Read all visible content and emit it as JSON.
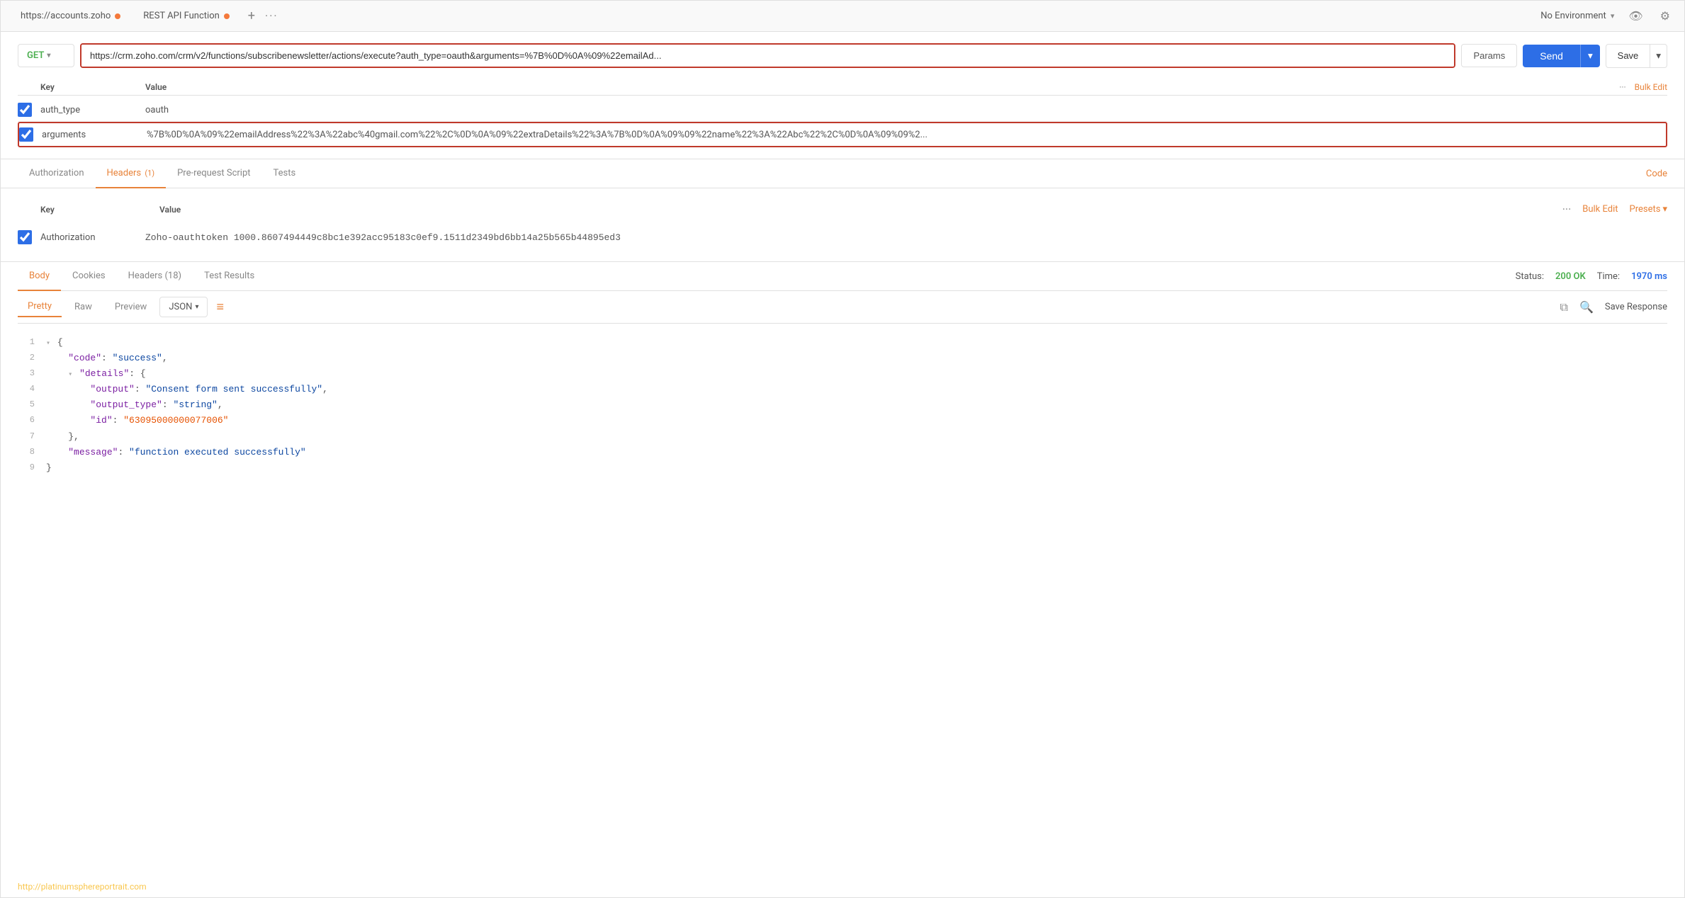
{
  "tabbar": {
    "tab1": {
      "label": "https://accounts.zoho",
      "dot_color": "#f4793b"
    },
    "tab2": {
      "label": "REST API Function",
      "dot_color": "#f4793b"
    },
    "plus": "+",
    "more": "···"
  },
  "env": {
    "label": "No Environment"
  },
  "urlbar": {
    "method": "GET",
    "url": "https://crm.zoho.com/crm/v2/functions/subscribenewsletter/actions/execute?auth_type=oauth&arguments=%7B%0D%0A%09%22emailAd...",
    "params_btn": "Params",
    "send_btn": "Send",
    "save_btn": "Save"
  },
  "params": {
    "headers": {
      "key": "Key",
      "value": "Value",
      "bulk_edit": "Bulk Edit"
    },
    "rows": [
      {
        "key": "auth_type",
        "value": "oauth",
        "checked": true,
        "highlighted": false
      },
      {
        "key": "arguments",
        "value": "%7B%0D%0A%09%22emailAddress%22%3A%22abc%40gmail.com%22%2C%0D%0A%09%22extraDetails%22%3A%7B%0D%0A%09%09%22name%22%3A%22Abc%22%2C%0D%0A%09%09%2...",
        "checked": true,
        "highlighted": true
      }
    ]
  },
  "request_tabs": {
    "items": [
      {
        "label": "Authorization",
        "active": false,
        "badge": ""
      },
      {
        "label": "Headers",
        "active": true,
        "badge": "(1)"
      },
      {
        "label": "Pre-request Script",
        "active": false,
        "badge": ""
      },
      {
        "label": "Tests",
        "active": false,
        "badge": ""
      }
    ],
    "code_link": "Code"
  },
  "headers_section": {
    "key_header": "Key",
    "value_header": "Value",
    "bulk_edit": "Bulk Edit",
    "presets": "Presets",
    "auth_row": {
      "key": "Authorization",
      "value": "Zoho-oauthtoken 1000.8607494449c8bc1e392acc95183c0ef9.1511d2349bd6bb14a25b565b44895ed3",
      "checked": true
    }
  },
  "response_tabs": {
    "items": [
      {
        "label": "Body",
        "active": true
      },
      {
        "label": "Cookies",
        "active": false
      },
      {
        "label": "Headers",
        "active": false,
        "badge": "(18)"
      },
      {
        "label": "Test Results",
        "active": false
      }
    ],
    "status_label": "Status:",
    "status_value": "200 OK",
    "time_label": "Time:",
    "time_value": "1970 ms"
  },
  "body_subtabs": {
    "items": [
      {
        "label": "Pretty",
        "active": true
      },
      {
        "label": "Raw",
        "active": false
      },
      {
        "label": "Preview",
        "active": false
      }
    ],
    "format": "JSON",
    "save_response": "Save Response"
  },
  "json_output": {
    "lines": [
      {
        "num": "1",
        "content": "{",
        "type": "bracket",
        "collapse": true
      },
      {
        "num": "2",
        "content": "\"code\": \"success\",",
        "indent": 1
      },
      {
        "num": "3",
        "content": "\"details\": {",
        "indent": 1,
        "collapse": true
      },
      {
        "num": "4",
        "content": "\"output\": \"Consent form sent successfully\",",
        "indent": 2
      },
      {
        "num": "5",
        "content": "\"output_type\": \"string\",",
        "indent": 2
      },
      {
        "num": "6",
        "content": "\"id\": \"63095000000077006\"",
        "indent": 2
      },
      {
        "num": "7",
        "content": "},",
        "indent": 1
      },
      {
        "num": "8",
        "content": "\"message\": \"function executed successfully\"",
        "indent": 1
      },
      {
        "num": "9",
        "content": "}",
        "indent": 0
      }
    ]
  },
  "footer": {
    "watermark": "http://platinumsphereportrait.com"
  }
}
